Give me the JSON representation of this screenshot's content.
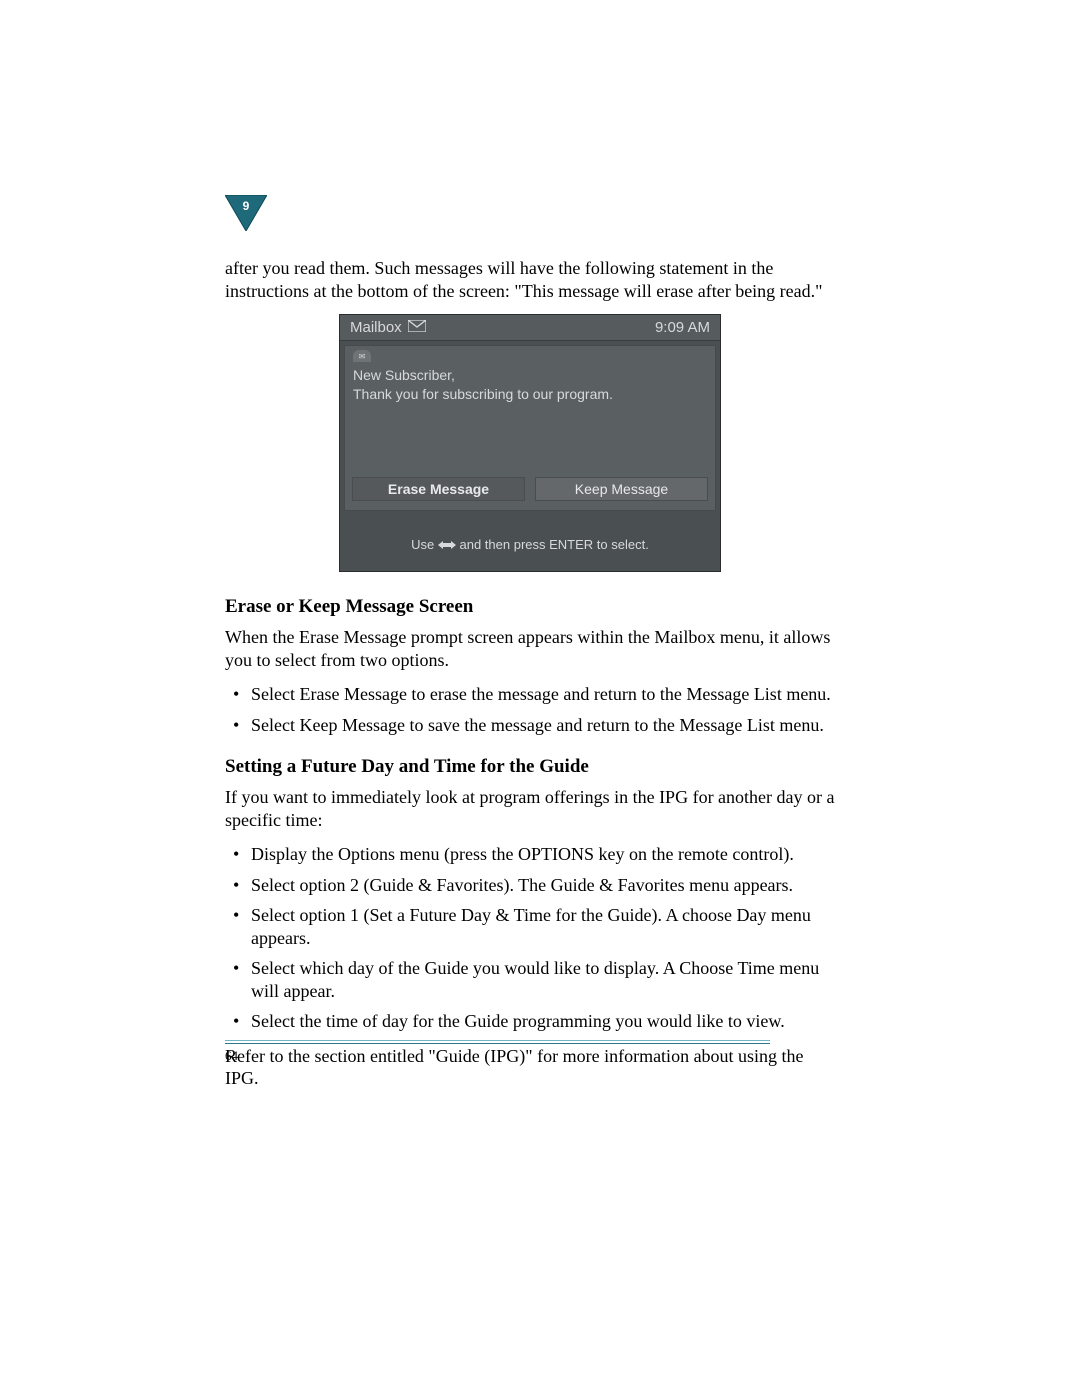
{
  "chapter_number": "9",
  "intro_paragraph": "after you read them. Such messages will have the following statement in the instructions at the bottom of the screen: \"This message will erase after being read.\"",
  "screenshot": {
    "header_title": "Mailbox",
    "header_time": "9:09 AM",
    "message_line1": "New Subscriber,",
    "message_line2": "Thank you for subscribing to our program.",
    "button_erase": "Erase Message",
    "button_keep": "Keep Message",
    "footer_prefix": "Use ",
    "footer_suffix": " and then press ENTER to select."
  },
  "section1": {
    "heading": "Erase or Keep Message Screen",
    "paragraph": "When the Erase Message prompt screen appears within the Mailbox menu, it allows you to select from two options.",
    "bullets": [
      "Select Erase Message to erase the message and return to the Message List menu.",
      "Select Keep Message to save the message and return to the Message List menu."
    ]
  },
  "section2": {
    "heading": "Setting a Future Day and Time for the Guide",
    "paragraph": "If you want to immediately look at program offerings in the IPG for another day or a specific time:",
    "bullets": [
      "Display the Options menu (press the OPTIONS key on the remote control).",
      "Select option 2 (Guide & Favorites). The Guide & Favorites menu appears.",
      "Select option 1 (Set a Future Day & Time for the Guide). A choose Day menu appears.",
      "Select which day of the Guide you would like to display. A Choose Time menu will appear.",
      "Select the time of day for the Guide programming you would like to view."
    ],
    "closing": "Refer to the section entitled \"Guide (IPG)\" for more information about using the IPG."
  },
  "page_number": "64"
}
